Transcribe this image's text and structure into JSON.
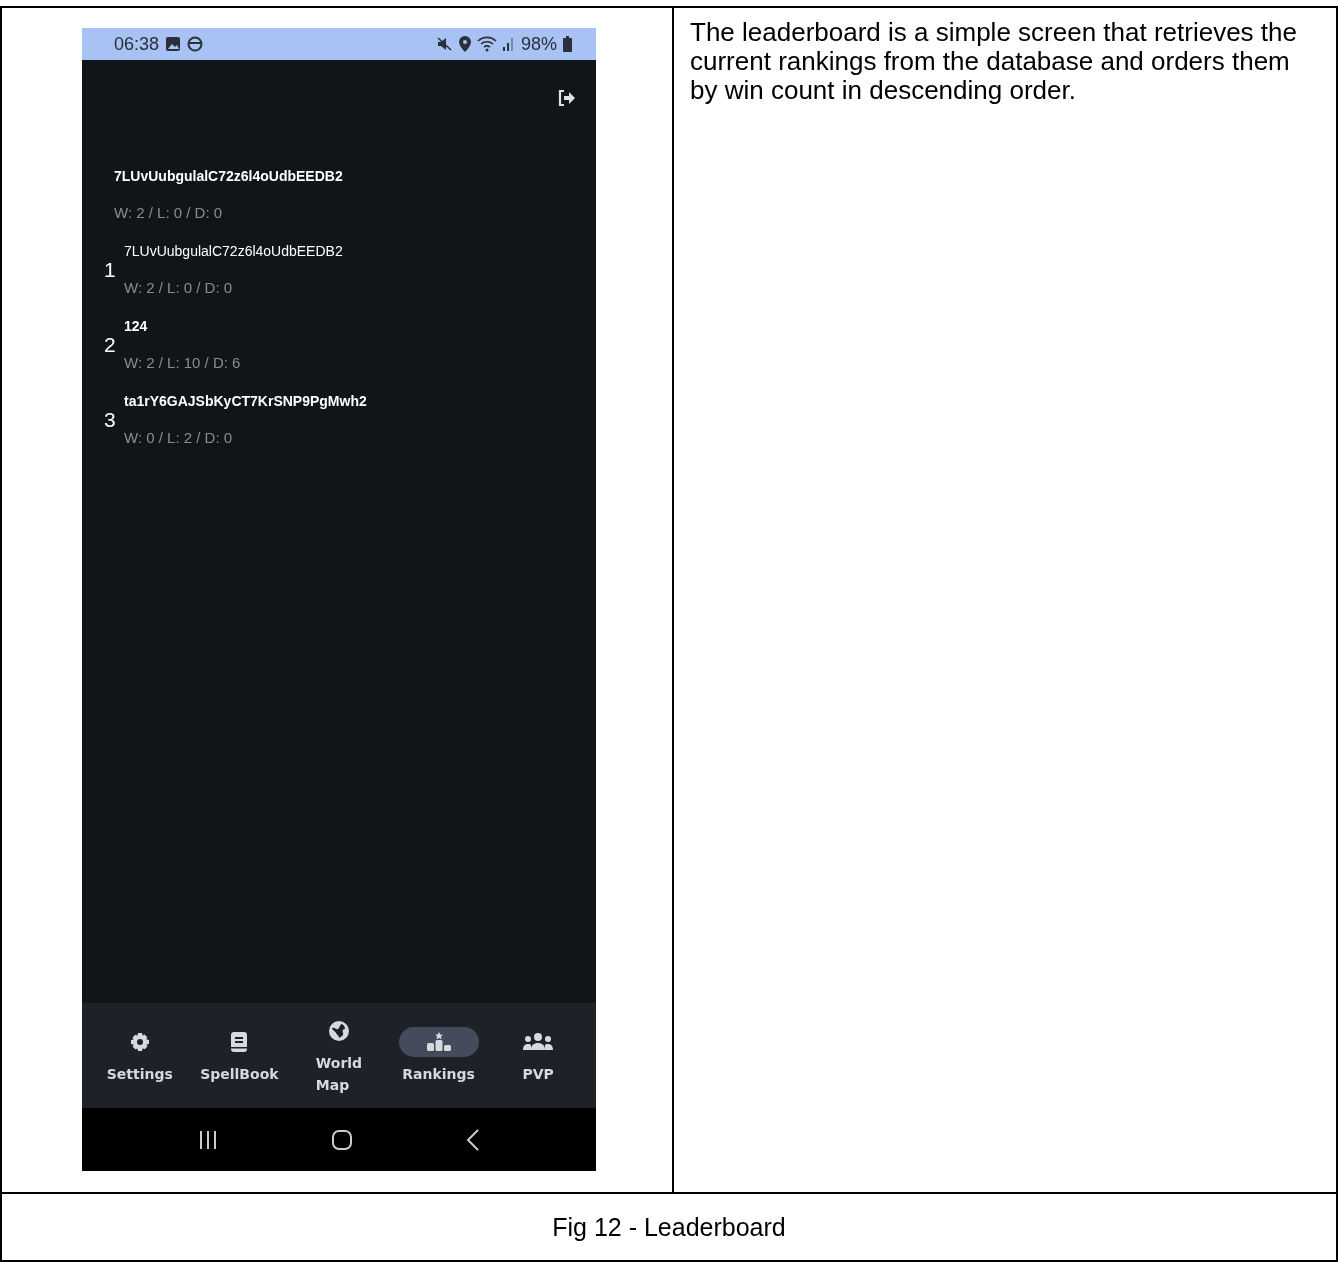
{
  "status_bar": {
    "time": "06:38",
    "battery": "98%"
  },
  "current_player": {
    "name": "7LUvUubgulalC72z6l4oUdbEEDB2",
    "record": "W: 2 / L: 0 / D: 0"
  },
  "rankings": [
    {
      "rank": "1",
      "name": "7LUvUubgulalC72z6l4oUdbEEDB2",
      "bold": false,
      "record": "W: 2 / L: 0 / D: 0"
    },
    {
      "rank": "2",
      "name": "124",
      "bold": true,
      "record": "W: 2 / L: 10 / D: 6"
    },
    {
      "rank": "3",
      "name": "ta1rY6GAJSbKyCT7KrSNP9PgMwh2",
      "bold": true,
      "record": "W: 0 / L: 2 / D: 0"
    }
  ],
  "nav_items": [
    {
      "kind": "settings",
      "label": "Settings",
      "selected": false
    },
    {
      "kind": "book",
      "label": "SpellBook",
      "selected": false
    },
    {
      "kind": "globe",
      "label": "World Map",
      "selected": false
    },
    {
      "kind": "podium",
      "label": "Rankings",
      "selected": true
    },
    {
      "kind": "group",
      "label": "PVP",
      "selected": false
    }
  ],
  "description": "The leaderboard is a simple screen that retrieves the current rankings from the database and orders them by win count in descending order.",
  "caption": "Fig 12 - Leaderboard"
}
